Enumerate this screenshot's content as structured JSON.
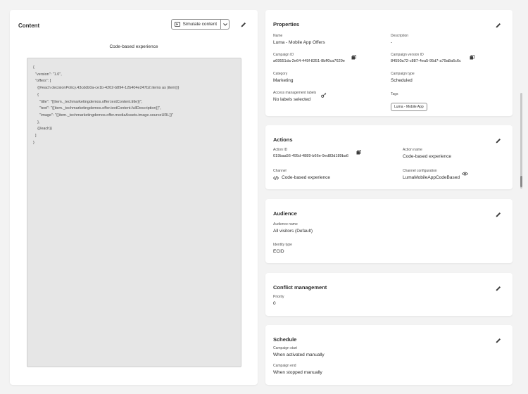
{
  "content": {
    "title": "Content",
    "simulate_label": "Simulate content",
    "subtitle": "Code-based experience",
    "code": "{\n  \"version\": \"1.0\",\n  \"offers\": [\n    {{#each decisionPolicy.43cddb0a-ce1b-4202-b894-12b404e247b2.items as |item|}}\n    {\n      \"title\": \"{{item._techmarketingdemos.offer.textContent.title}}\",\n      \"text\": \"{{item._techmarketingdemos.offer.textContent.fullDescription}}\",\n      \"image\": \"{{item._techmarketingdemos.offer.mediaAssets.image.sourceURL}}\"\n    },\n    {{/each}}\n  ]\n}"
  },
  "properties": {
    "title": "Properties",
    "name_label": "Name",
    "name_value": "Luma - Mobile App Offers",
    "description_label": "Description",
    "description_value": "-",
    "campaign_id_label": "Campaign ID",
    "campaign_id_value": "a69551da-2e64-449f-8351-8bff0ca7629e",
    "campaign_version_id_label": "Campaign version ID",
    "campaign_version_id_value": "84550a72-c887-4ea5-95d7-a79a8a6c6c",
    "category_label": "Category",
    "category_value": "Marketing",
    "campaign_type_label": "Campaign type",
    "campaign_type_value": "Scheduled",
    "access_label": "Access management labels",
    "access_value": "No labels selected",
    "tags_label": "Tags",
    "tag_value": "Luma - Mobile App"
  },
  "actions": {
    "title": "Actions",
    "action_id_label": "Action ID",
    "action_id_value": "019baa56-495d-4889-b66e-9ed83d189ba6",
    "action_name_label": "Action name",
    "action_name_value": "Code-based experience",
    "channel_label": "Channel",
    "channel_value": "Code-based experience",
    "channel_config_label": "Channel configuration",
    "channel_config_value": "LumaMobileAppCodeBased"
  },
  "audience": {
    "title": "Audience",
    "audience_name_label": "Audience name",
    "audience_name_value": "All visitors (Default)",
    "identity_type_label": "Identity type",
    "identity_type_value": "ECID"
  },
  "conflict": {
    "title": "Conflict management",
    "priority_label": "Priority",
    "priority_value": "0"
  },
  "schedule": {
    "title": "Schedule",
    "start_label": "Campaign start",
    "start_value": "When activated manually",
    "end_label": "Campaign end",
    "end_value": "When stopped manually"
  },
  "icons": {
    "edit": "pencil-icon",
    "copy": "copy-icon",
    "key": "key-icon",
    "eye": "eye-icon",
    "code": "code-icon",
    "simulate": "simulate-icon",
    "dropdown": "chevron-down-icon"
  }
}
